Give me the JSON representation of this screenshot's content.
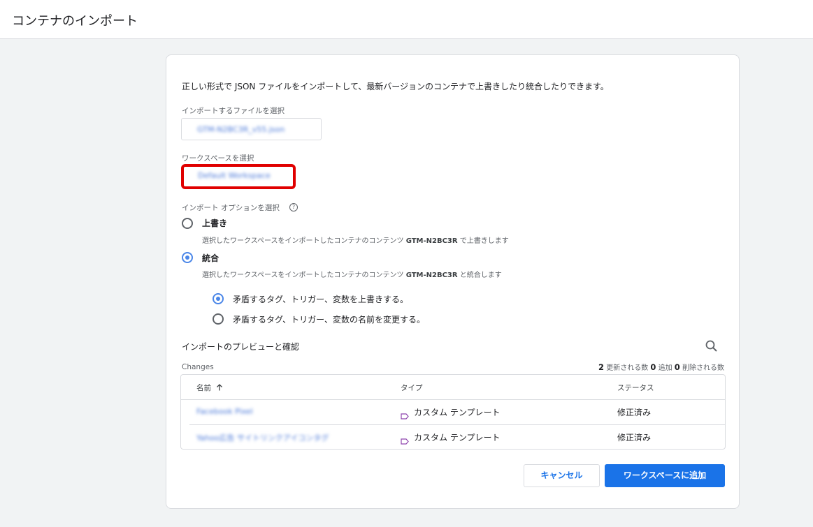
{
  "header": {
    "title": "コンテナのインポート"
  },
  "intro": "正しい形式で JSON ファイルをインポートして、最新バージョンのコンテナで上書きしたり統合したりできます。",
  "file_select": {
    "label": "インポートするファイルを選択",
    "value": "GTM-N2BC3R_v55.json"
  },
  "workspace_select": {
    "label": "ワークスペースを選択",
    "value": "Default Workspace"
  },
  "import_options": {
    "label": "インポート オプションを選択",
    "help_icon": "help-circle-icon",
    "options": [
      {
        "label": "上書き",
        "desc_before": "選択したワークスペースをインポートしたコンテナのコンテンツ",
        "container": "GTM-N2BC3R",
        "desc_after": "で上書きします",
        "selected": false
      },
      {
        "label": "統合",
        "desc_before": "選択したワークスペースをインポートしたコンテナのコンテンツ",
        "container": "GTM-N2BC3R",
        "desc_after": "と統合します",
        "selected": true
      }
    ],
    "merge_options": [
      {
        "label": "矛盾するタグ、トリガー、変数を上書きする。",
        "selected": true
      },
      {
        "label": "矛盾するタグ、トリガー、変数の名前を変更する。",
        "selected": false
      }
    ]
  },
  "preview": {
    "title": "インポートのプレビューと確認",
    "search_icon": "search-icon",
    "changes_label": "Changes",
    "summary": {
      "updated": "2",
      "updated_label": "更新される数",
      "added": "0",
      "added_label": "追加",
      "deleted": "0",
      "deleted_label": "削除される数"
    },
    "columns": {
      "name": "名前",
      "sort_icon": "arrow-up-icon",
      "type": "タイプ",
      "status": "ステータス"
    },
    "rows": [
      {
        "name": "Facebook Pixel",
        "type": "カスタム テンプレート",
        "status": "修正済み"
      },
      {
        "name": "Yahoo広告 サイトリンクアイコンタグ",
        "type": "カスタム テンプレート",
        "status": "修正済み"
      }
    ]
  },
  "buttons": {
    "cancel": "キャンセル",
    "add": "ワークスペースに追加"
  },
  "colors": {
    "accent": "#1a73e8",
    "highlight": "#e00000",
    "radio": "#4a86e8"
  }
}
